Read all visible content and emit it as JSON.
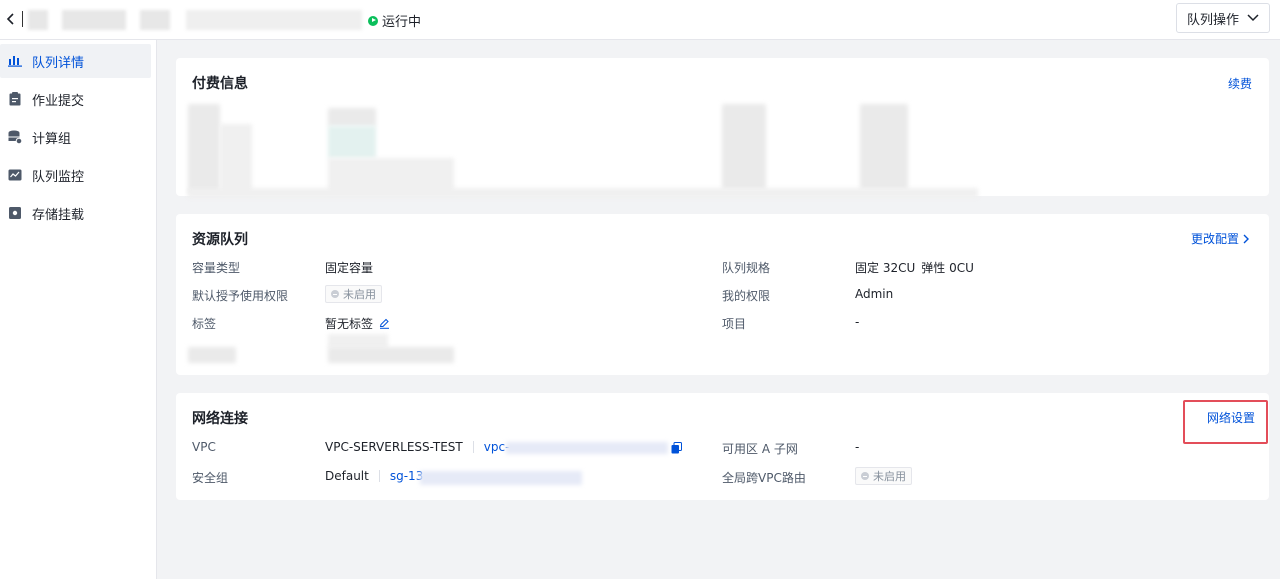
{
  "header": {
    "status_label": "运行中",
    "queue_ops_label": "队列操作",
    "colors": {
      "running": "#0abf5b"
    }
  },
  "sidebar": {
    "items": [
      {
        "label": "队列详情",
        "icon": "bar-chart-icon",
        "active": true
      },
      {
        "label": "作业提交",
        "icon": "clipboard-icon"
      },
      {
        "label": "计算组",
        "icon": "database-icon"
      },
      {
        "label": "队列监控",
        "icon": "monitor-chart-icon"
      },
      {
        "label": "存储挂载",
        "icon": "storage-icon"
      }
    ]
  },
  "billing": {
    "title": "付费信息",
    "renew_label": "续费"
  },
  "resource": {
    "title": "资源队列",
    "change_label": "更改配置",
    "capacity_type_label": "容量类型",
    "capacity_type_value": "固定容量",
    "default_auth_label": "默认授予使用权限",
    "default_auth_value": "未启用",
    "tags_label": "标签",
    "tags_value": "暂无标签",
    "spec_label": "队列规格",
    "spec_fixed": "固定 32CU",
    "spec_elastic": "弹性 0CU",
    "my_perm_label": "我的权限",
    "my_perm_value": "Admin",
    "project_label": "项目",
    "project_value": "-"
  },
  "network": {
    "title": "网络连接",
    "settings_label": "网络设置",
    "vpc_label": "VPC",
    "vpc_name": "VPC-SERVERLESS-TEST",
    "vpc_id_prefix": "vpc-",
    "sg_label": "安全组",
    "sg_name": "Default",
    "sg_id_prefix": "sg-13",
    "zone_subnet_label": "可用区 A 子网",
    "zone_subnet_value": "-",
    "cross_vpc_label": "全局跨VPC路由",
    "cross_vpc_value": "未启用"
  },
  "colors": {
    "link": "#0052d9",
    "highlight": "#e34d59"
  }
}
